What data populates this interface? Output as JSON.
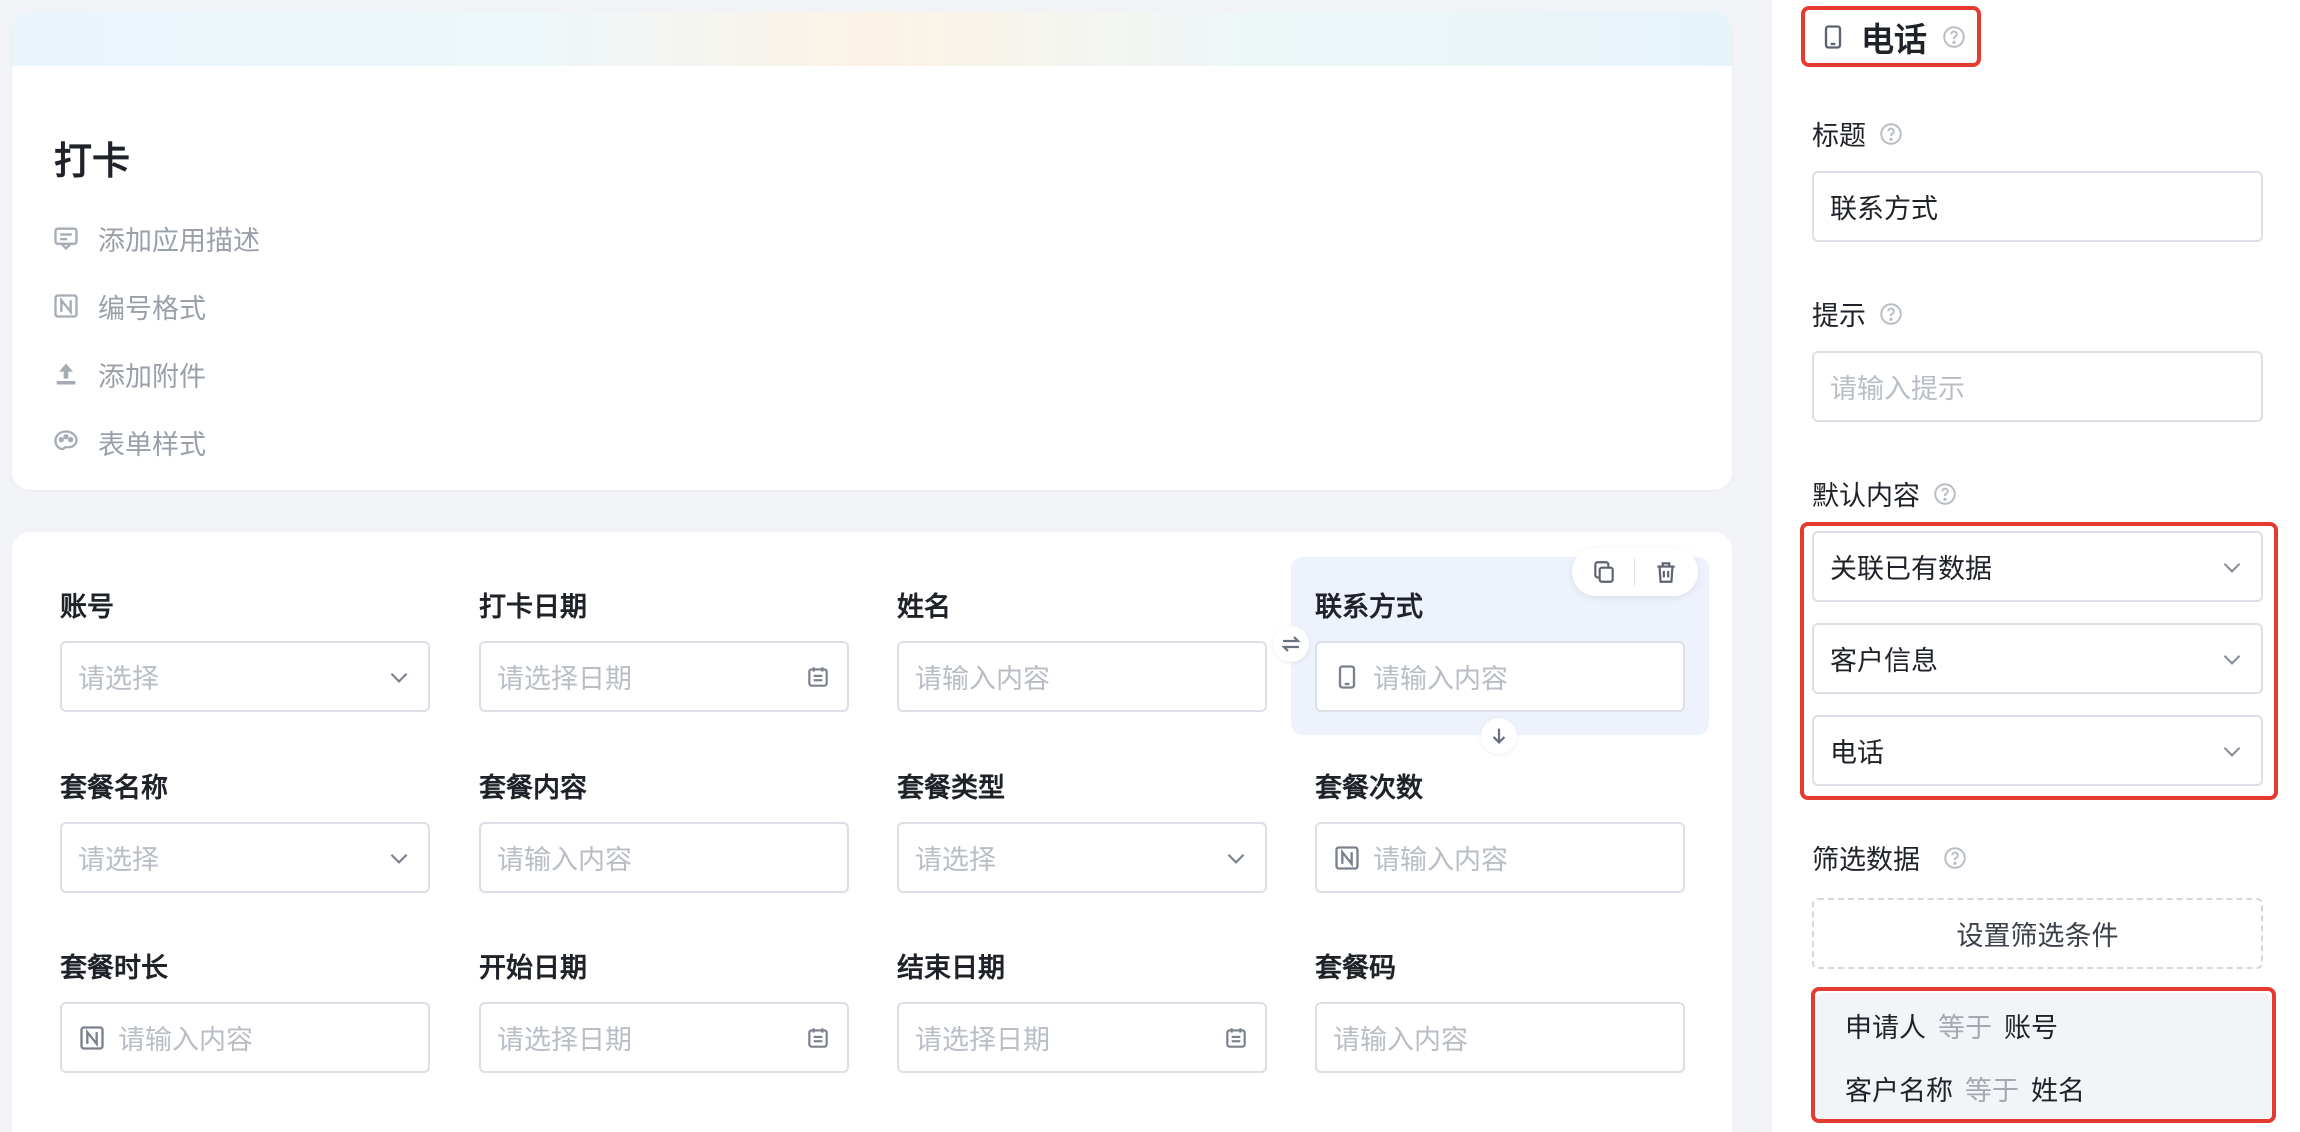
{
  "app": {
    "title": "打卡",
    "meta": [
      {
        "label": "添加应用描述",
        "icon": "comment-icon"
      },
      {
        "label": "编号格式",
        "icon": "number-format-icon"
      },
      {
        "label": "添加附件",
        "icon": "upload-icon"
      },
      {
        "label": "表单样式",
        "icon": "palette-icon"
      }
    ]
  },
  "form": {
    "fields": [
      {
        "label": "账号",
        "placeholder": "请选择",
        "kind": "select"
      },
      {
        "label": "打卡日期",
        "placeholder": "请选择日期",
        "kind": "date"
      },
      {
        "label": "姓名",
        "placeholder": "请输入内容",
        "kind": "text"
      },
      {
        "label": "联系方式",
        "placeholder": "请输入内容",
        "kind": "phone",
        "selected": true
      },
      {
        "label": "套餐名称",
        "placeholder": "请选择",
        "kind": "select"
      },
      {
        "label": "套餐内容",
        "placeholder": "请输入内容",
        "kind": "text"
      },
      {
        "label": "套餐类型",
        "placeholder": "请选择",
        "kind": "select"
      },
      {
        "label": "套餐次数",
        "placeholder": "请输入内容",
        "kind": "number"
      },
      {
        "label": "套餐时长",
        "placeholder": "请输入内容",
        "kind": "number"
      },
      {
        "label": "开始日期",
        "placeholder": "请选择日期",
        "kind": "date"
      },
      {
        "label": "结束日期",
        "placeholder": "请选择日期",
        "kind": "date"
      },
      {
        "label": "套餐码",
        "placeholder": "请输入内容",
        "kind": "text"
      }
    ]
  },
  "panel": {
    "type_title": "电话",
    "title_label": "标题",
    "title_value": "联系方式",
    "hint_label": "提示",
    "hint_placeholder": "请输入提示",
    "default_label": "默认内容",
    "default_selects": [
      "关联已有数据",
      "客户信息",
      "电话"
    ],
    "filter_label": "筛选数据",
    "filter_button": "设置筛选条件",
    "conditions": [
      {
        "field": "申请人",
        "op": "等于",
        "value": "账号"
      },
      {
        "field": "客户名称",
        "op": "等于",
        "value": "姓名"
      }
    ]
  },
  "colors": {
    "highlight_border": "#e53a2f",
    "selected_field_bg": "#eef2fc"
  }
}
